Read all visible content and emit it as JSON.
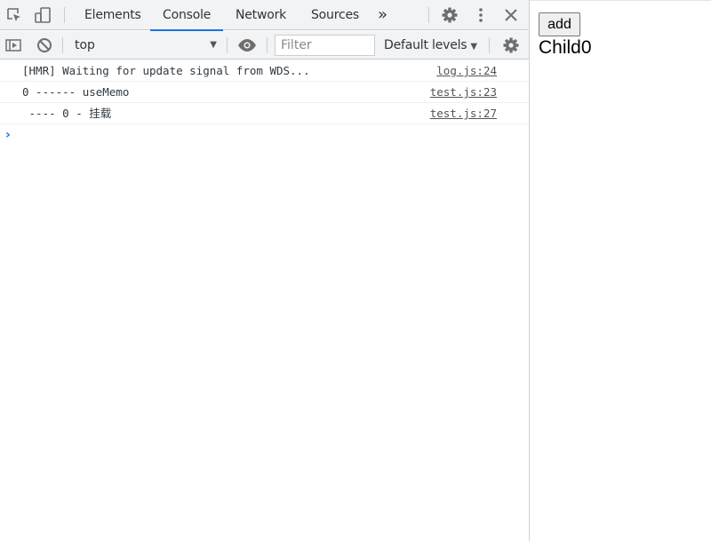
{
  "devtools": {
    "tabs": [
      {
        "label": "Elements"
      },
      {
        "label": "Console"
      },
      {
        "label": "Network"
      },
      {
        "label": "Sources"
      }
    ],
    "more_tabs_glyph": "»",
    "toolbar": {
      "context": "top",
      "filter_placeholder": "Filter",
      "levels": "Default levels"
    },
    "logs": [
      {
        "message": "[HMR] Waiting for update signal from WDS...",
        "source": "log.js:24"
      },
      {
        "message": "0 ------ useMemo",
        "source": "test.js:23"
      },
      {
        "message": " ---- 0 - 挂载",
        "source": "test.js:27"
      }
    ],
    "prompt": "›",
    "colors": {
      "accent": "#1a73e8",
      "icon": "#6e6e6e"
    }
  },
  "page": {
    "button_label": "add",
    "child_text": "Child0"
  }
}
